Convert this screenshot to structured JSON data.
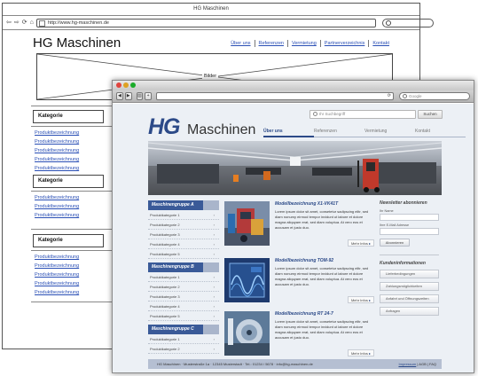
{
  "wireframe": {
    "window_title": "HG Maschinen",
    "url": "http://www.hg-maschinen.de",
    "logo": "HG Maschinen",
    "menu": [
      "Über uns",
      "Referenzen",
      "Vermietung",
      "Partnerverzeichnis",
      "Kontakt"
    ],
    "banner_label": "Bilder",
    "categories": [
      {
        "title": "Kategorie",
        "links": [
          "Produktbezeichnung",
          "Produktbezeichnung",
          "Produktbezeichnung",
          "Produktbezeichnung",
          "Produktbezeichnung"
        ]
      },
      {
        "title": "Kategorie",
        "links": [
          "Produktbezeichnung",
          "Produktbezeichnung",
          "Produktbezeichnung"
        ]
      },
      {
        "title": "Kategorie",
        "links": [
          "Produktbezeichnung",
          "Produktbezeichnung",
          "Produktbezeichnung",
          "Produktbezeichnung",
          "Produktbezeichnung"
        ]
      }
    ]
  },
  "mockup": {
    "browser_search_placeholder": "Google",
    "logo_hg": "HG",
    "logo_rest": "Maschinen",
    "search_placeholder": "Ihr Suchbegriff",
    "search_button": "Suchen",
    "tabs": [
      "Über uns",
      "Referenzen",
      "Vermietung",
      "Kontakt"
    ],
    "groups": [
      {
        "title": "Maschinengruppe A",
        "items": [
          "Produktkategorie 1",
          "Produktkategorie 2",
          "Produktkategorie 3",
          "Produktkategorie 4",
          "Produktkategorie 5"
        ]
      },
      {
        "title": "Maschinengruppe B",
        "items": [
          "Produktkategorie 1",
          "Produktkategorie 2",
          "Produktkategorie 3",
          "Produktkategorie 4",
          "Produktkategorie 5"
        ]
      },
      {
        "title": "Maschinengruppe C",
        "items": [
          "Produktkategorie 1",
          "Produktkategorie 2"
        ]
      }
    ],
    "products": [
      {
        "title": "Modellbezeichnung X1-VK41T",
        "text": "Lorem ipsum dolor sit amet, consetetur sadipscing elitr, sed diam nonumy eirmod tempor invidunt ut labore et dolore magna aliquyam erat, sed diam voluptua. At vero eos et accusam et justo duo.",
        "more": "Mehr Infos"
      },
      {
        "title": "Modellbezeichnung TOM-92",
        "text": "Lorem ipsum dolor sit amet, consetetur sadipscing elitr, sed diam nonumy eirmod tempor invidunt ut labore et dolore magna aliquyam erat, sed diam voluptua. At vero eos et accusam et justo duo.",
        "more": "Mehr Infos"
      },
      {
        "title": "Modellbezeichnung RT 24-7",
        "text": "Lorem ipsum dolor sit amet, consetetur sadipscing elitr, sed diam nonumy eirmod tempor invidunt ut labore et dolore magna aliquyam erat, sed diam voluptua. At vero eos et accusam et justo duo.",
        "more": "Mehr Infos"
      }
    ],
    "newsletter": {
      "title": "Newsletter abonnieren",
      "name_label": "Ihr Name",
      "email_label": "Ihre E-Mail Adresse",
      "button": "Abonnieren"
    },
    "kunden": {
      "title": "Kundeninformationen",
      "buttons": [
        "Lieferbedingungen",
        "Zahlungsmöglichkeiten",
        "Anfahrt und Öffnungszeiten",
        "Anfragen"
      ]
    },
    "footer_left": "HG Maschinen · Musterstraße 1a · 12345 Musterstadt · Tel.: 01234 / 5678 · info@hg-maschinen.de",
    "footer_right_link": "Impressum",
    "footer_right_text": "| AGB | FAQ"
  },
  "colors": {
    "brand_blue": "#2c4a88",
    "group_header": "#3a5a98",
    "link_blue": "#2a4fb5",
    "page_bg": "#ecf0f5"
  }
}
